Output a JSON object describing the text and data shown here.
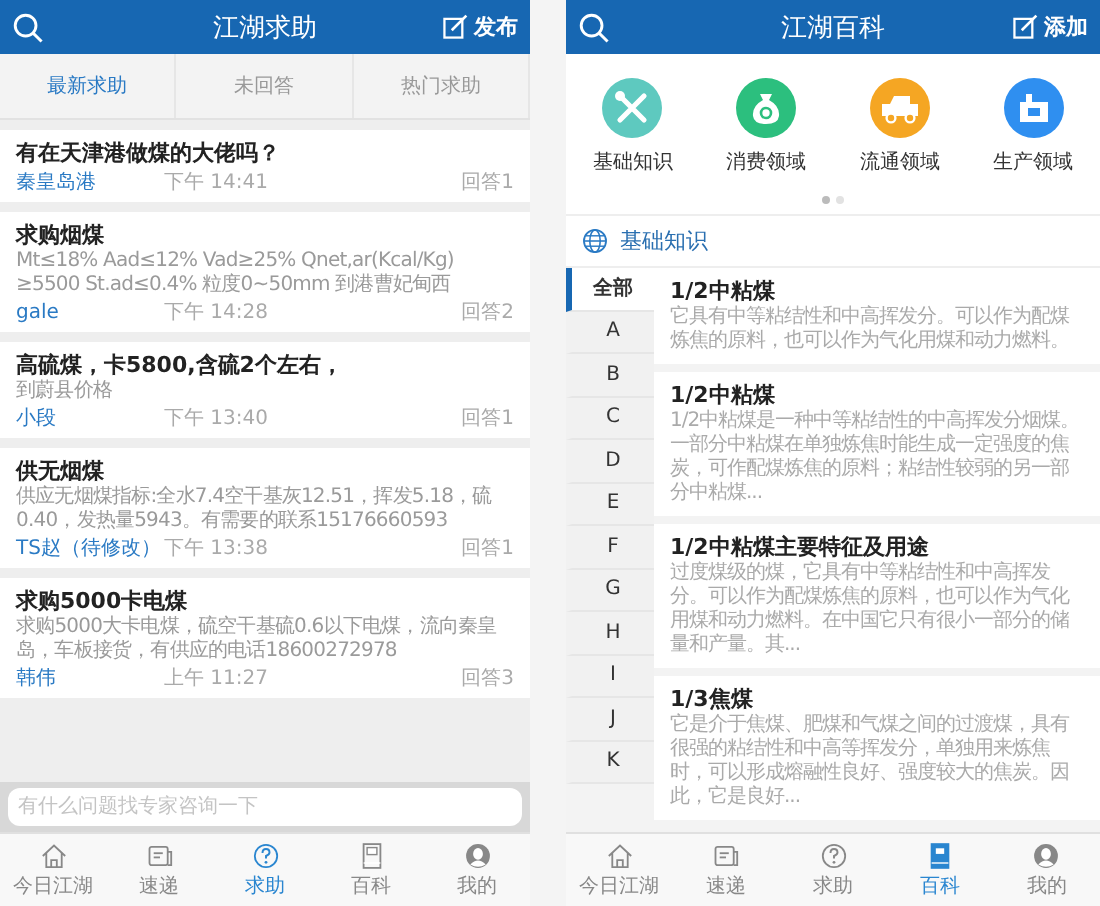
{
  "help_screen": {
    "header": {
      "title": "江湖求助",
      "action_label": "发布"
    },
    "tabs": [
      {
        "label": "最新求助",
        "selected": true
      },
      {
        "label": "未回答",
        "selected": false
      },
      {
        "label": "热门求助",
        "selected": false
      }
    ],
    "posts": [
      {
        "title": "有在天津港做煤的大佬吗？",
        "author": "秦皇岛港",
        "time": "下午 14:41",
        "answers": "回答1"
      },
      {
        "title": "求购烟煤",
        "body": "Mt≤18%  Aad≤12%  Vad≥25%  Qnet,ar(Kcal/Kg) ≥5500 St.ad≤0.4%  粒度0~50mm    到港曹妃甸西",
        "author": "gale",
        "time": "下午 14:28",
        "answers": "回答2"
      },
      {
        "title": "高硫煤，卡5800,含硫2个左右，",
        "body": "到蔚县价格",
        "author": "小段",
        "time": "下午 13:40",
        "answers": "回答1"
      },
      {
        "title": "供无烟煤",
        "body": "供应无烟煤指标:全水7.4空干基灰12.51，挥发5.18，硫0.40，发热量5943。有需要的联系15176660593",
        "author": "TS赵（待修改）",
        "time": "下午 13:38",
        "answers": "回答1"
      },
      {
        "title": "求购5000卡电煤",
        "body": "求购5000大卡电煤，硫空干基硫0.6以下电煤，流向秦皇岛，车板接货，有供应的电话18600272978",
        "author": "韩伟",
        "time": "上午 11:27",
        "answers": "回答3"
      }
    ],
    "ask_field": {
      "placeholder": "有什么问题找专家咨询一下"
    },
    "nav": [
      {
        "label": "今日江湖",
        "selected": false
      },
      {
        "label": "速递",
        "selected": false
      },
      {
        "label": "求助",
        "selected": true
      },
      {
        "label": "百科",
        "selected": false
      },
      {
        "label": "我的",
        "selected": false
      }
    ]
  },
  "encyclopedia_screen": {
    "header": {
      "title": "江湖百科",
      "action_label": "添加"
    },
    "categories": [
      {
        "label": "基础知识",
        "color": "#5ec9bf"
      },
      {
        "label": "消费领域",
        "color": "#2cbf7e"
      },
      {
        "label": "流通领域",
        "color": "#f5a623"
      },
      {
        "label": "生产领域",
        "color": "#2f8ff0"
      }
    ],
    "pager_dots": [
      {
        "selected": true
      },
      {
        "selected": false
      }
    ],
    "section_title": "基础知识",
    "index": [
      {
        "label": "全部",
        "selected": true
      },
      {
        "label": "A",
        "selected": false
      },
      {
        "label": "B",
        "selected": false
      },
      {
        "label": "C",
        "selected": false
      },
      {
        "label": "D",
        "selected": false
      },
      {
        "label": "E",
        "selected": false
      },
      {
        "label": "F",
        "selected": false
      },
      {
        "label": "G",
        "selected": false
      },
      {
        "label": "H",
        "selected": false
      },
      {
        "label": "I",
        "selected": false
      },
      {
        "label": "J",
        "selected": false
      },
      {
        "label": "K",
        "selected": false
      }
    ],
    "articles": [
      {
        "title": "1/2中粘煤",
        "summary": "它具有中等粘结性和中高挥发分。可以作为配煤炼焦的原料，也可以作为气化用煤和动力燃料。"
      },
      {
        "title": "1/2中粘煤",
        "summary": "1/2中粘煤是一种中等粘结性的中高挥发分烟煤。一部分中粘煤在单独炼焦时能生成一定强度的焦炭，可作配煤炼焦的原料；粘结性较弱的另一部分中粘煤..."
      },
      {
        "title": "1/2中粘煤主要特征及用途",
        "summary": "过度煤级的煤，它具有中等粘结性和中高挥发分。可以作为配煤炼焦的原料，也可以作为气化用煤和动力燃料。在中国它只有很小一部分的储量和产量。其..."
      },
      {
        "title": "1/3焦煤",
        "summary": "它是介于焦煤、肥煤和气煤之间的过渡煤，具有很强的粘结性和中高等挥发分，单独用来炼焦时，可以形成熔融性良好、强度较大的焦炭。因此，它是良好..."
      }
    ],
    "nav": [
      {
        "label": "今日江湖",
        "selected": false
      },
      {
        "label": "速递",
        "selected": false
      },
      {
        "label": "求助",
        "selected": false
      },
      {
        "label": "百科",
        "selected": true
      },
      {
        "label": "我的",
        "selected": false
      }
    ]
  }
}
